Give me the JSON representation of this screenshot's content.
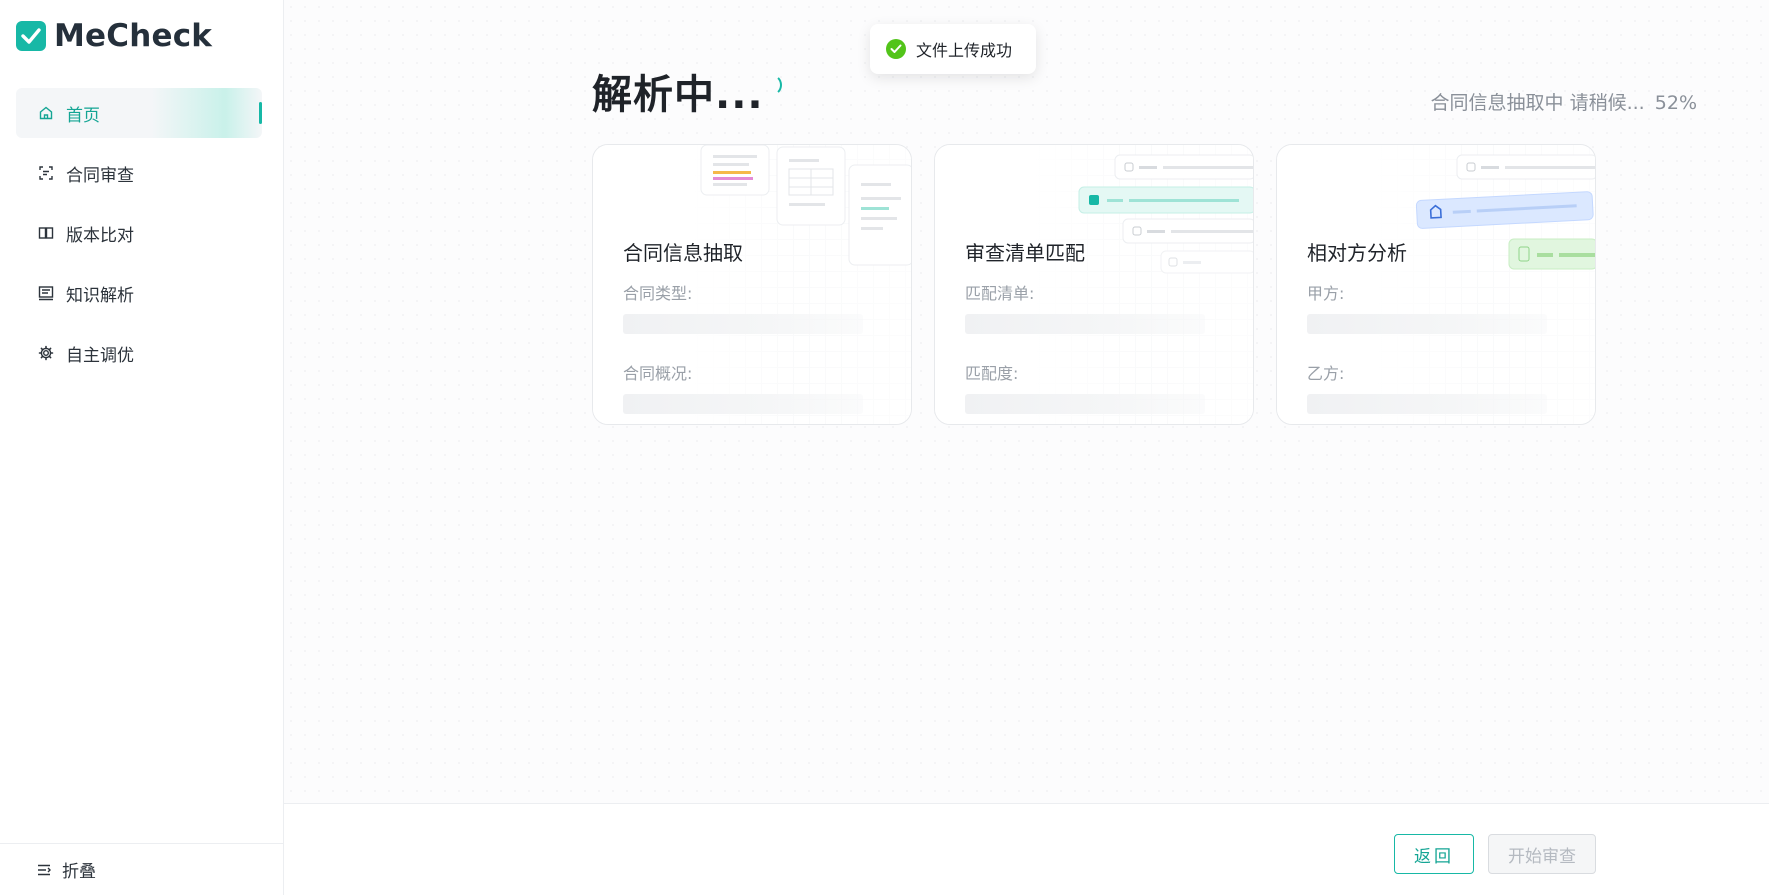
{
  "app": {
    "logo_text": "MeCheck",
    "accent": "#17b8a6"
  },
  "sidebar": {
    "items": [
      {
        "label": "首页",
        "icon": "home-icon",
        "active": true
      },
      {
        "label": "合同审查",
        "icon": "scan-doc-icon",
        "active": false
      },
      {
        "label": "版本比对",
        "icon": "compare-icon",
        "active": false
      },
      {
        "label": "知识解析",
        "icon": "knowledge-icon",
        "active": false
      },
      {
        "label": "自主调优",
        "icon": "gear-icon",
        "active": false
      }
    ],
    "collapse_label": "折叠"
  },
  "toast": {
    "text": "文件上传成功",
    "status_color": "#52c41a"
  },
  "main": {
    "title": "解析中...",
    "progress_text": "合同信息抽取中 请稍候...",
    "progress_percent": "52%"
  },
  "cards": [
    {
      "title": "合同信息抽取",
      "fields": [
        "合同类型:",
        "合同概况:"
      ]
    },
    {
      "title": "审查清单匹配",
      "fields": [
        "匹配清单:",
        "匹配度:"
      ]
    },
    {
      "title": "相对方分析",
      "fields": [
        "甲方:",
        "乙方:"
      ]
    }
  ],
  "footer": {
    "back_label": "返回",
    "start_label": "开始审查"
  }
}
